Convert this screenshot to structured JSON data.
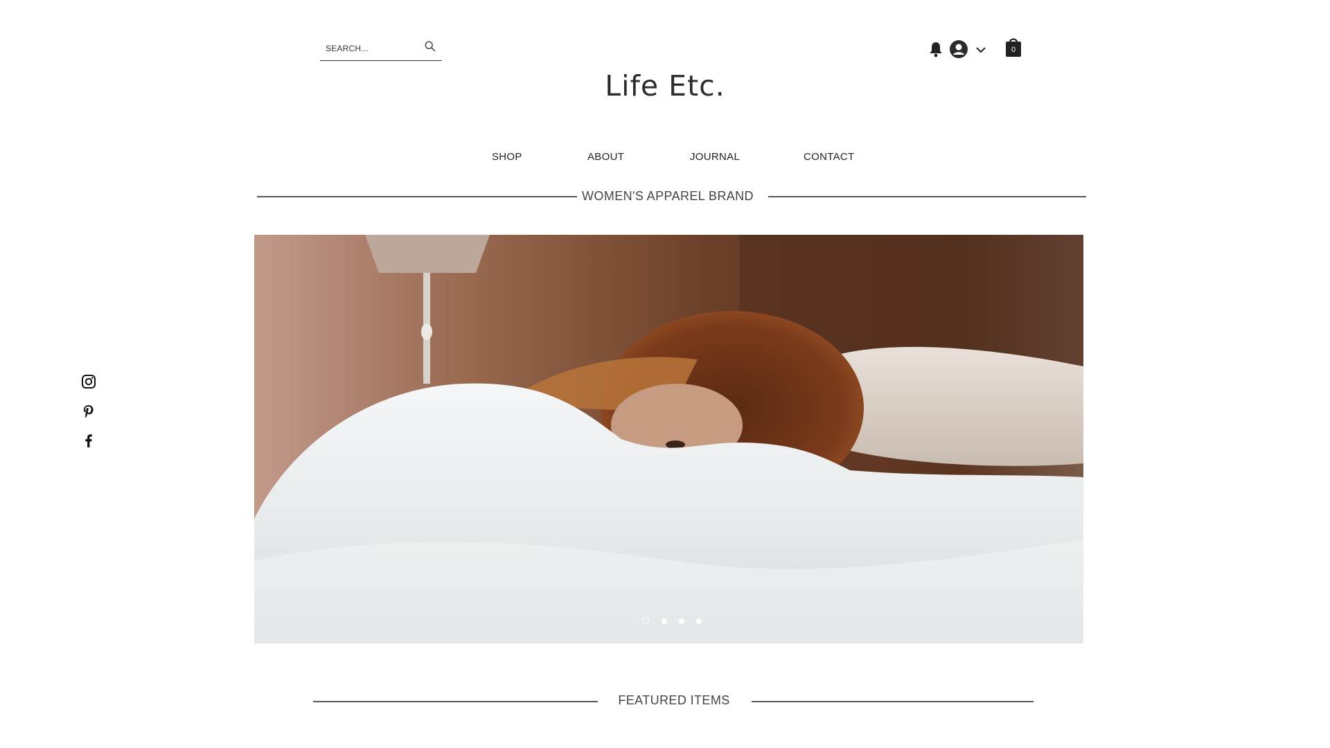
{
  "header": {
    "search": {
      "placeholder": "SEARCH..."
    },
    "logo": "Life Etc.",
    "cart": {
      "count": "0"
    }
  },
  "nav": {
    "items": [
      {
        "label": "SHOP"
      },
      {
        "label": "ABOUT"
      },
      {
        "label": "JOURNAL"
      },
      {
        "label": "CONTACT"
      }
    ]
  },
  "tagline": "WOMEN'S APPAREL BRAND",
  "hero": {
    "slide_count": 4,
    "active_slide": 1,
    "dots": [
      "1",
      "2",
      "3",
      "4"
    ]
  },
  "featured": {
    "heading": "FEATURED ITEMS"
  },
  "social": {
    "icons": [
      "instagram-icon",
      "pinterest-icon",
      "facebook-icon"
    ]
  },
  "colors": {
    "background": "#ffffff",
    "text": "#222222",
    "rule": "#555555"
  }
}
